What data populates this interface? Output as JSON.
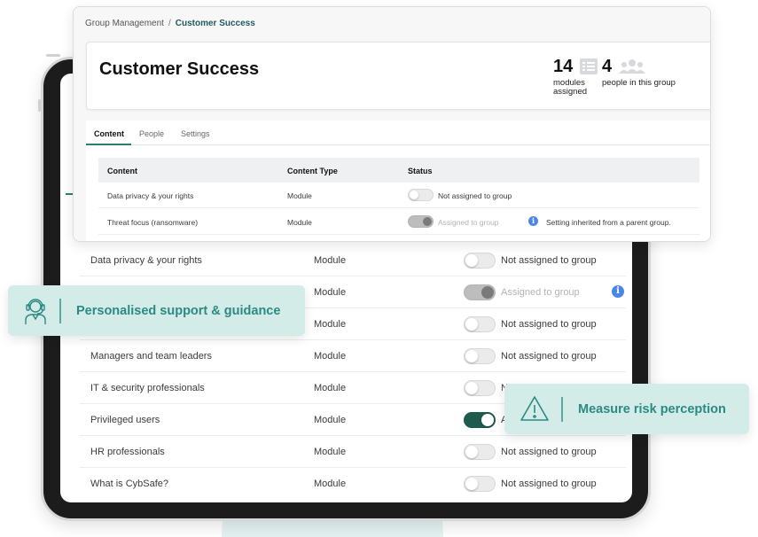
{
  "panel": {
    "breadcrumb": {
      "parent": "Group Management",
      "separator": "/",
      "current": "Customer Success"
    },
    "title": "Customer Success",
    "stats": {
      "modules_count": "14",
      "modules_label_line1": "modules",
      "modules_label_line2": "assigned",
      "people_count": "4",
      "people_label": "people in this group"
    },
    "tabs": [
      {
        "label": "Content",
        "active": true
      },
      {
        "label": "People",
        "active": false
      },
      {
        "label": "Settings",
        "active": false
      }
    ],
    "table": {
      "headers": {
        "content": "Content",
        "type": "Content Type",
        "status": "Status"
      },
      "rows": [
        {
          "content": "Data privacy & your rights",
          "type": "Module",
          "status": "Not assigned to group",
          "toggle": "off"
        },
        {
          "content": "Threat focus (ransomware)",
          "type": "Module",
          "status": "Assigned to group",
          "toggle": "disabled",
          "note": "Setting inherited from a parent group."
        }
      ]
    }
  },
  "tablet": {
    "rows": [
      {
        "content": "Data privacy & your rights",
        "type": "Module",
        "status": "Not assigned to group",
        "toggle": "off"
      },
      {
        "content": "",
        "type": "Module",
        "status": "Assigned to group",
        "toggle": "disabled",
        "info": true
      },
      {
        "content": "",
        "type": "Module",
        "status": "Not assigned to group",
        "toggle": "off"
      },
      {
        "content": "Managers and team leaders",
        "type": "Module",
        "status": "Not assigned to group",
        "toggle": "off"
      },
      {
        "content": "IT & security professionals",
        "type": "Module",
        "status": "N",
        "toggle": "off"
      },
      {
        "content": "Privileged users",
        "type": "Module",
        "status": "A",
        "toggle": "on"
      },
      {
        "content": "HR professionals",
        "type": "Module",
        "status": "Not assigned to group",
        "toggle": "off"
      },
      {
        "content": "What is CybSafe?",
        "type": "Module",
        "status": "Not assigned to group",
        "toggle": "off"
      }
    ]
  },
  "callouts": {
    "support": {
      "label": "Personalised support & guidance",
      "icon": "support-agent-icon"
    },
    "risk": {
      "label": "Measure risk perception",
      "icon": "warning-triangle-icon"
    }
  },
  "colors": {
    "accent": "#2b7d76",
    "callout_bg": "#d3ece8",
    "callout_text": "#2b8a82",
    "toggle_on": "#1f5a4e",
    "info_blue": "#4a86e8"
  }
}
